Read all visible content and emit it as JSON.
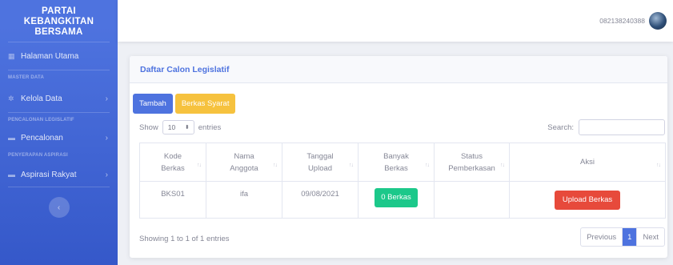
{
  "sidebar": {
    "brand_line1": "PARTAI",
    "brand_line2": "KEBANGKITAN",
    "brand_line3": "BERSAMA",
    "items": [
      {
        "label": "Halaman Utama"
      },
      {
        "label": "Kelola Data"
      },
      {
        "label": "Pencalonan"
      },
      {
        "label": "Aspirasi Rakyat"
      }
    ],
    "headings": [
      "MASTER DATA",
      "PENCALONAN LEGISLATIF",
      "PENYERAPAN ASPIRASI"
    ],
    "toggle_icon": "‹"
  },
  "topbar": {
    "user_name": "082138240388"
  },
  "card": {
    "title": "Daftar Calon Legislatif",
    "btn_tambah": "Tambah",
    "btn_berkas": "Berkas Syarat",
    "show_label": "Show",
    "entries_value": "10",
    "entries_label": "entries",
    "search_label": "Search:",
    "columns": [
      "Kode Berkas",
      "Nama Anggota",
      "Tanggal Upload",
      "Banyak Berkas",
      "Status Pemberkasan",
      "Aksi"
    ],
    "columns_lines": [
      [
        "Kode",
        "Berkas"
      ],
      [
        "Nama",
        "Anggota"
      ],
      [
        "Tanggal",
        "Upload"
      ],
      [
        "Banyak",
        "Berkas"
      ],
      [
        "Status",
        "Pemberkasan"
      ],
      [
        "Aksi",
        ""
      ]
    ],
    "rows": [
      {
        "kode": "BKS01",
        "nama": "ifa",
        "tanggal": "09/08/2021",
        "banyak": "0 Berkas",
        "status": "",
        "aksi": "Upload Berkas"
      }
    ],
    "info": "Showing 1 to 1 of 1 entries",
    "pager": {
      "previous": "Previous",
      "page": "1",
      "next": "Next"
    }
  },
  "colors": {
    "primary": "#4e73df",
    "warning": "#f6c23e",
    "success": "#1cc88a",
    "danger": "#e74a3b"
  }
}
